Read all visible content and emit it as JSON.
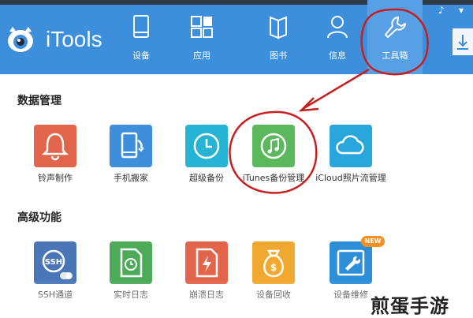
{
  "app": {
    "name": "iTools"
  },
  "nav": [
    {
      "label": "设备",
      "icon": "tablet-icon"
    },
    {
      "label": "应用",
      "icon": "apps-grid-icon"
    },
    {
      "label": "图书",
      "icon": "book-icon"
    },
    {
      "label": "信息",
      "icon": "user-icon"
    },
    {
      "label": "工具箱",
      "icon": "wrench-icon",
      "active": true
    }
  ],
  "sections": {
    "data_management": {
      "title": "数据管理",
      "tools": [
        {
          "label": "铃声制作",
          "icon": "bell-icon",
          "color": "#e2644a"
        },
        {
          "label": "手机搬家",
          "icon": "phone-transfer-icon",
          "color": "#3d8fdc"
        },
        {
          "label": "超级备份",
          "icon": "clock-icon",
          "color": "#27b3d4"
        },
        {
          "label": "iTunes备份管理",
          "icon": "music-note-icon",
          "color": "#5cb85c"
        },
        {
          "label": "iCloud照片流管理",
          "icon": "cloud-icon",
          "color": "#29a7dc"
        }
      ]
    },
    "advanced": {
      "title": "高级功能",
      "tools": [
        {
          "label": "SSH通道",
          "icon": "ssh-icon",
          "color": "#4a76b8"
        },
        {
          "label": "实时日志",
          "icon": "document-clock-icon",
          "color": "#4caa58"
        },
        {
          "label": "崩溃日志",
          "icon": "document-bolt-icon",
          "color": "#e2644a"
        },
        {
          "label": "设备回收",
          "icon": "money-bag-icon",
          "color": "#f0a830"
        },
        {
          "label": "设备维修",
          "icon": "tablet-wrench-icon",
          "color": "#2d8fd8",
          "badge": "NEW"
        }
      ]
    }
  },
  "watermark": "煎蛋手游"
}
